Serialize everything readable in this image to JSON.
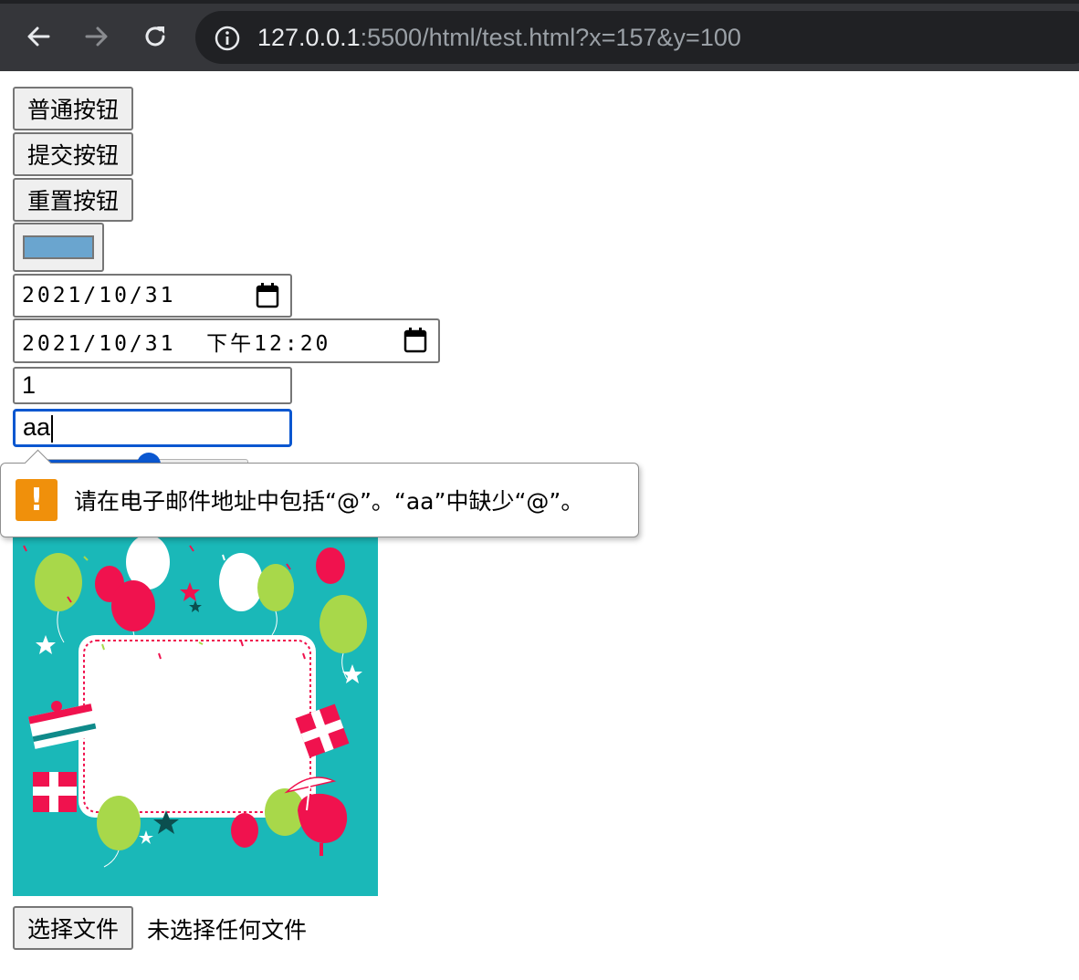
{
  "browser": {
    "back_icon": "arrow-left-icon",
    "forward_icon": "arrow-right-icon",
    "reload_icon": "reload-icon",
    "site_info_icon": "info-icon",
    "url_host": "127.0.0.1",
    "url_rest": ":5500/html/test.html?x=157&y=100"
  },
  "form": {
    "normal_button": "普通按钮",
    "submit_button": "提交按钮",
    "reset_button": "重置按钮",
    "color_value": "#6aa5cf",
    "date_value": "2021/10/31",
    "datetime_value": "2021/10/31  下午12:20",
    "number_value": "1",
    "email_value": "aa",
    "range_value_percent": 55,
    "file_button": "选择文件",
    "file_status": "未选择任何文件"
  },
  "tooltip": {
    "icon": "warning-icon",
    "message": "请在电子邮件地址中包括“@”。“aa”中缺少“@”。"
  },
  "colors": {
    "image_background": "#1ab8b8",
    "balloon_green": "#a8d84a",
    "balloon_red": "#f0124e",
    "focus_blue": "#0b57d0",
    "warning_orange": "#f0900b"
  }
}
